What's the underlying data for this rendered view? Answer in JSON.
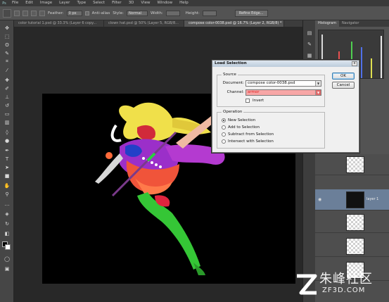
{
  "menubar": {
    "logo": "Ps",
    "items": [
      "File",
      "Edit",
      "Image",
      "Layer",
      "Type",
      "Select",
      "Filter",
      "3D",
      "View",
      "Window",
      "Help"
    ]
  },
  "options": {
    "feather_label": "Feather:",
    "feather_value": "0 px",
    "antialias_label": "Anti-alias",
    "style_label": "Style:",
    "style_value": "Normal",
    "width_label": "Width:",
    "height_label": "Height:",
    "refine_edge": "Refine Edge..."
  },
  "doc_tabs": [
    "color tutorial 1.psd @ 33.3% (Layer 6 copy...",
    "clown hat.psd @ 50% (Layer 5, RGB/8...",
    "compose color-0038.psd @ 16.7% (Layer 2, RGB/8) *"
  ],
  "panel_tabs": {
    "histogram": "Histogram",
    "navigator": "Navigator"
  },
  "layers": [
    {
      "name": ""
    },
    {
      "name": "layer 1"
    },
    {
      "name": ""
    },
    {
      "name": ""
    },
    {
      "name": ""
    }
  ],
  "dialog": {
    "title": "Load Selection",
    "close": "x",
    "source_label": "Source",
    "document_label": "Document:",
    "document_value": "compose color-0038.psd",
    "channel_label": "Channel:",
    "channel_value": "armor",
    "invert_label": "Invert",
    "operation_label": "Operation",
    "operations": [
      "New Selection",
      "Add to Selection",
      "Subtract from Selection",
      "Intersect with Selection"
    ],
    "selected_operation": 0,
    "ok": "OK",
    "cancel": "Cancel"
  },
  "watermark": {
    "zh": "朱峰社区",
    "en": "ZF3D.COM"
  },
  "colors": {
    "channel_highlight": "#f7a6a6",
    "canvas": "#000000",
    "dialog_bg": "#f0f0f0"
  }
}
